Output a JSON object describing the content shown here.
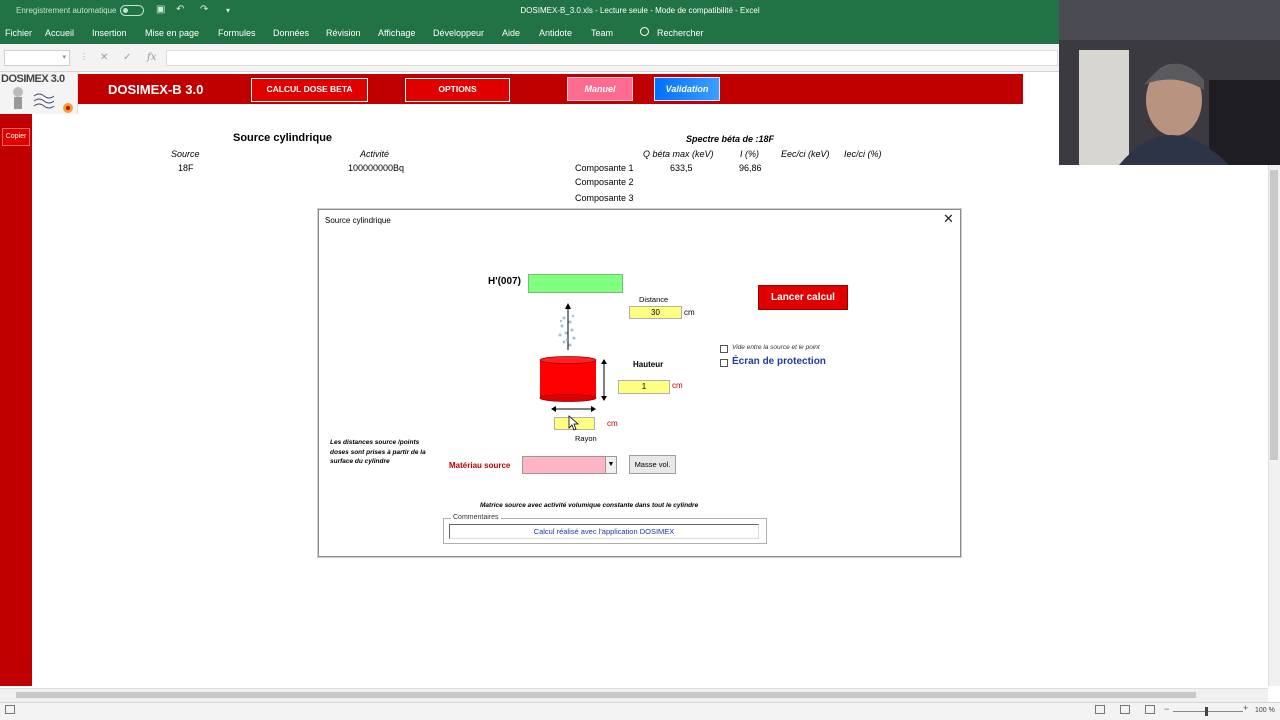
{
  "titlebar": {
    "autosave_label": "Enregistrement automatique",
    "document_title": "DOSIMEX-B_3.0.xls  -  Lecture seule  -  Mode de compatibilité  -  Excel"
  },
  "ribbon": {
    "tabs": [
      "Fichier",
      "Accueil",
      "Insertion",
      "Mise en page",
      "Formules",
      "Données",
      "Révision",
      "Affichage",
      "Développeur",
      "Aide",
      "Antidote",
      "Team"
    ],
    "search_label": "Rechercher"
  },
  "formulabar": {
    "fx_label": "fx"
  },
  "sheet": {
    "logo_text": "DOSIMEX 3.0",
    "app_name": "DOSIMEX-B 3.0",
    "buttons": {
      "calcul": "CALCUL DOSE BETA",
      "options": "OPTIONS",
      "manuel": "Manuel",
      "validation": "Validation",
      "copier": "Copier"
    },
    "source_title": "Source cylindrique",
    "col_source": "Source",
    "col_activite": "Activité",
    "source_value": "18F",
    "activite_value": "100000000Bq",
    "spectre_title": "Spectre béta de :18F",
    "spectre_headers": [
      "Q béta max (keV)",
      "I (%)",
      "Eec/ci (keV)",
      "Iec/ci (%)"
    ],
    "composantes": [
      {
        "label": "Composante 1",
        "q": "633,5",
        "i": "96,86"
      },
      {
        "label": "Composante 2",
        "q": "",
        "i": ""
      },
      {
        "label": "Composante 3",
        "q": "",
        "i": ""
      }
    ]
  },
  "dialog": {
    "title": "Source cylindrique",
    "close": "✕",
    "hprime_label": "H'(007)",
    "hprime_value": "",
    "distance_label": "Distance",
    "distance_value": "30",
    "distance_unit": "cm",
    "hauteur_label": "Hauteur",
    "hauteur_value": "1",
    "hauteur_unit": "cm",
    "rayon_label": "Rayon",
    "rayon_value": "",
    "rayon_unit": "cm",
    "lancer_button": "Lancer calcul",
    "vide_label": "Vide entre la source et le point",
    "ecran_label": "Écran de protection",
    "note_text": "Les distances source /points doses sont prises à partir de la surface du cylindre",
    "materiau_label": "Matériau source",
    "materiau_value": "",
    "masse_button": "Masse vol.",
    "matrice_note": "Matrice source avec activité volumique constante dans tout le cylindre",
    "commentaires_legend": "Commentaires",
    "commentaires_value": "Calcul réalisé avec l'application DOSIMEX"
  },
  "statusbar": {
    "zoom": "100 %"
  },
  "colors": {
    "excel_green": "#217346",
    "dosimex_red": "#c00000",
    "button_red": "#e00000",
    "input_yellow": "#ffff80",
    "result_green": "#80ff80",
    "material_pink": "#ffb4c4"
  }
}
